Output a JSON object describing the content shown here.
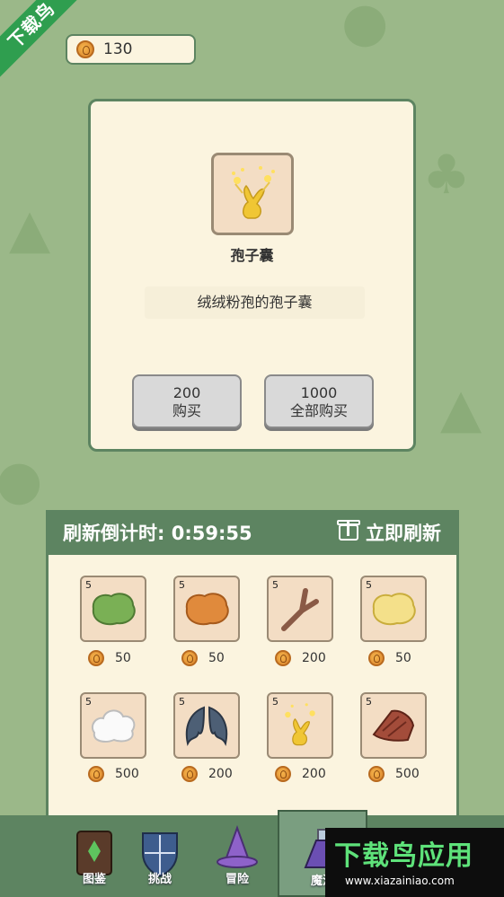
{
  "ribbon": {
    "text": "下载鸟"
  },
  "currency": {
    "amount": "130"
  },
  "detail": {
    "item_name": "孢子囊",
    "description": "绒绒粉孢的孢子囊",
    "buy_price": "200",
    "buy_label": "购买",
    "buy_all_price": "1000",
    "buy_all_label": "全部购买"
  },
  "shop": {
    "countdown": "刷新倒计时: 0:59:55",
    "refresh_label": "立即刷新",
    "items": [
      {
        "qty": "5",
        "icon": "green-slime",
        "price": "50"
      },
      {
        "qty": "5",
        "icon": "orange-slime",
        "price": "50"
      },
      {
        "qty": "5",
        "icon": "branch",
        "price": "200"
      },
      {
        "qty": "5",
        "icon": "yellow-slime",
        "price": "50"
      },
      {
        "qty": "5",
        "icon": "cloud-fluff",
        "price": "500"
      },
      {
        "qty": "5",
        "icon": "bat-wings",
        "price": "200"
      },
      {
        "qty": "5",
        "icon": "spore-sac",
        "price": "200"
      },
      {
        "qty": "5",
        "icon": "meat",
        "price": "500"
      }
    ]
  },
  "nav": {
    "tabs": [
      {
        "label": "图鉴",
        "icon": "book-icon"
      },
      {
        "label": "挑战",
        "icon": "shield-icon"
      },
      {
        "label": "冒险",
        "icon": "wizard-hat-icon"
      },
      {
        "label": "魔法",
        "icon": "potion-icon"
      }
    ]
  },
  "watermark": {
    "title": "下载鸟应用",
    "url": "www.xiazainiao.com"
  },
  "colors": {
    "panel_green": "#5d8461",
    "background": "#9bb889",
    "paper": "#fbf4df"
  }
}
